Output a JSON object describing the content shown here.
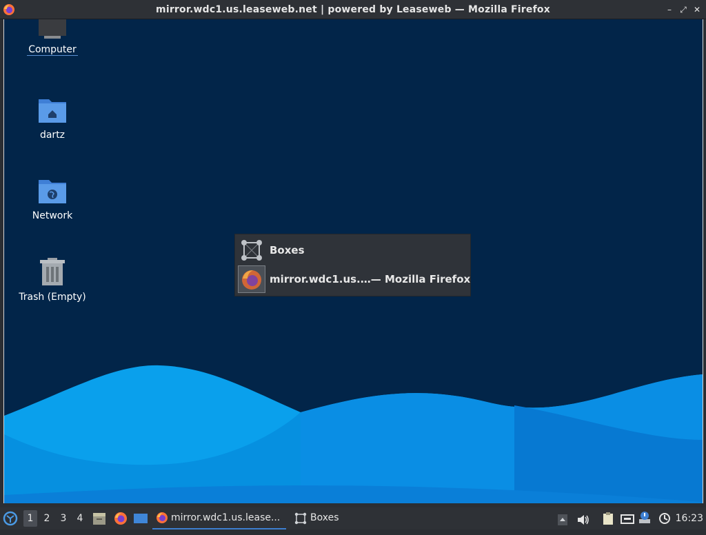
{
  "window": {
    "title": "mirror.wdc1.us.leaseweb.net | powered by Leaseweb — Mozilla Firefox",
    "controls": {
      "minimize": "–",
      "restore": "⤢",
      "close": "✕"
    }
  },
  "desktop": {
    "icons": [
      {
        "label": "Computer",
        "icon": "computer-icon"
      },
      {
        "label": "dartz",
        "icon": "home-folder-icon"
      },
      {
        "label": "Network",
        "icon": "network-folder-icon"
      },
      {
        "label": "Trash (Empty)",
        "icon": "trash-icon"
      }
    ],
    "colors": {
      "background": "#022549",
      "wave_light": "#0aa0ec",
      "wave_mid": "#0a86dc",
      "wave_dark": "#0762c4"
    }
  },
  "switcher": {
    "items": [
      {
        "label": "Boxes",
        "icon": "boxes-icon"
      },
      {
        "label": "mirror.wdc1.us.…— Mozilla Firefox",
        "icon": "firefox-icon",
        "selected": true
      }
    ]
  },
  "taskbar": {
    "workspaces": [
      "1",
      "2",
      "3",
      "4"
    ],
    "active_workspace": "1",
    "launchers": [
      "file-manager-icon",
      "firefox-icon",
      "show-desktop-icon"
    ],
    "tasks": [
      {
        "label": "mirror.wdc1.us.lease...",
        "icon": "firefox-icon",
        "active": true
      },
      {
        "label": "Boxes",
        "icon": "boxes-icon",
        "active": false
      }
    ],
    "tray": [
      "scroll-up-icon",
      "volume-icon",
      "clipboard-icon",
      "network-wired-icon",
      "notification-icon",
      "update-icon"
    ],
    "clock": "16:23"
  }
}
